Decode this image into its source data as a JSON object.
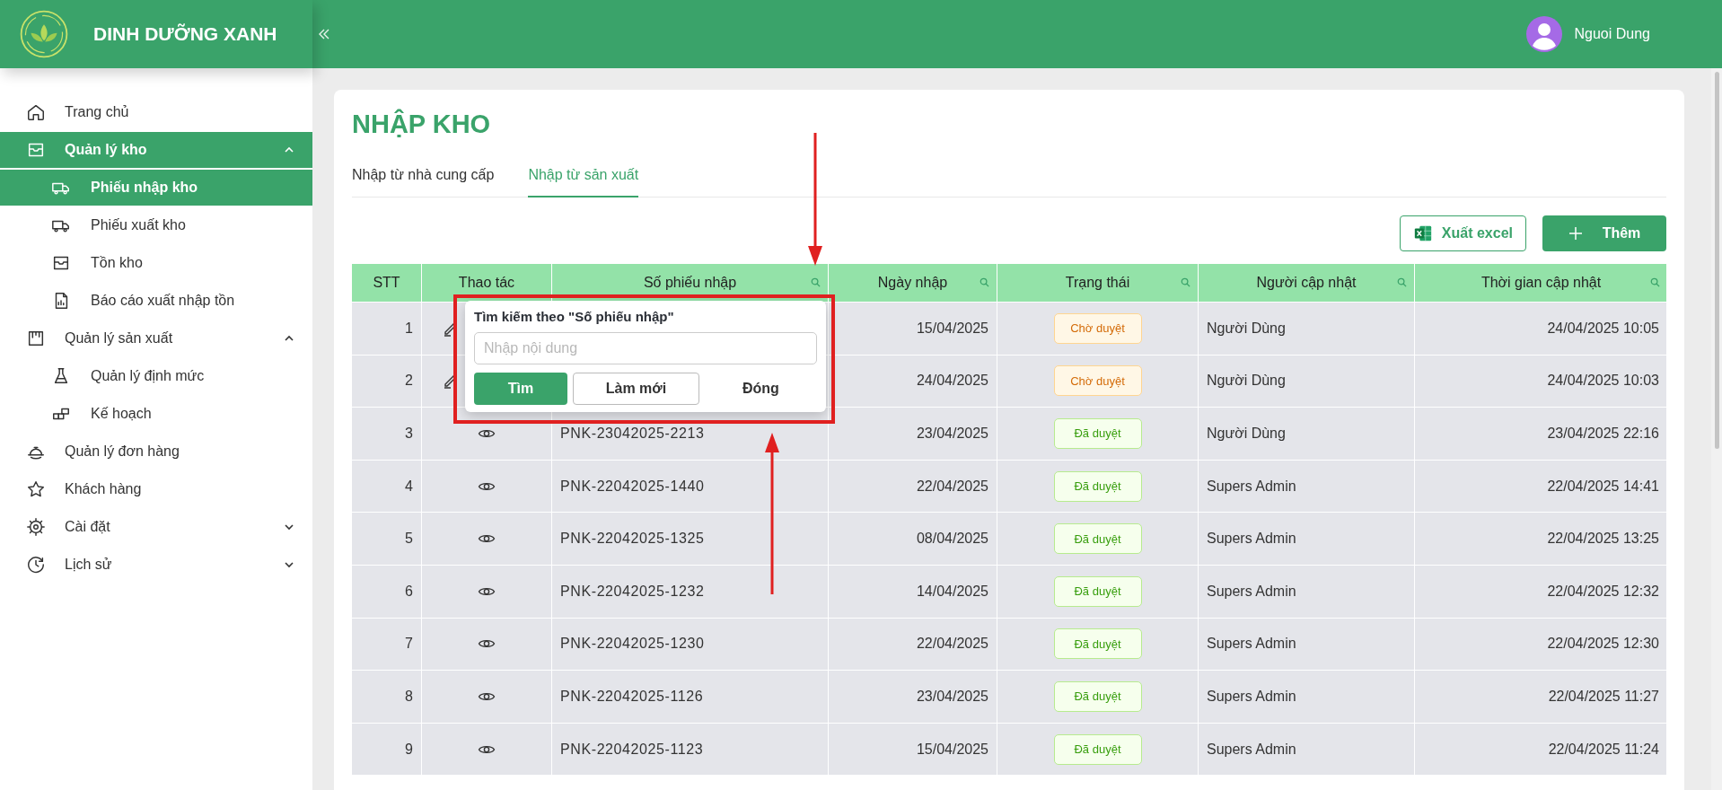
{
  "app": {
    "brand": "DINH DƯỠNG XANH"
  },
  "user": {
    "name": "Nguoi Dung"
  },
  "sidebar": {
    "items": [
      {
        "label": "Trang chủ",
        "selected": false
      },
      {
        "label": "Quản lý kho",
        "selected": true,
        "expanded": true,
        "children": [
          {
            "label": "Phiếu nhập kho",
            "selected": true
          },
          {
            "label": "Phiếu xuất kho",
            "selected": false
          },
          {
            "label": "Tồn kho",
            "selected": false
          },
          {
            "label": "Báo cáo xuất nhập tồn",
            "selected": false
          }
        ]
      },
      {
        "label": "Quản lý sản xuất",
        "selected": false,
        "expanded": true,
        "children": [
          {
            "label": "Quản lý định mức",
            "selected": false
          },
          {
            "label": "Kế hoạch",
            "selected": false
          }
        ]
      },
      {
        "label": "Quản lý đơn hàng",
        "selected": false
      },
      {
        "label": "Khách hàng",
        "selected": false
      },
      {
        "label": "Cài đặt",
        "selected": false,
        "expanded": false
      },
      {
        "label": "Lịch sử",
        "selected": false,
        "expanded": false
      }
    ]
  },
  "page": {
    "title": "NHẬP KHO",
    "tabs": [
      {
        "label": "Nhập từ nhà cung cấp",
        "selected": false
      },
      {
        "label": "Nhập từ sản xuất",
        "selected": true
      }
    ],
    "actions": {
      "export": "Xuất excel",
      "add": "Thêm"
    }
  },
  "table": {
    "columns": [
      {
        "label": "STT",
        "filterable": false
      },
      {
        "label": "Thao tác",
        "filterable": false
      },
      {
        "label": "Số phiếu nhập",
        "filterable": true
      },
      {
        "label": "Ngày nhập",
        "filterable": true
      },
      {
        "label": "Trạng thái",
        "filterable": true
      },
      {
        "label": "Người cập nhật",
        "filterable": true
      },
      {
        "label": "Thời gian cập nhật",
        "filterable": true
      }
    ],
    "rows": [
      {
        "stt": "1",
        "kind": "edit",
        "date": "15/04/2025",
        "status": {
          "label": "Chờ duyệt",
          "kind": "pending"
        },
        "updated_by": "Người Dùng",
        "updated_at": "24/04/2025 10:05"
      },
      {
        "stt": "2",
        "kind": "edit",
        "date": "24/04/2025",
        "status": {
          "label": "Chờ duyệt",
          "kind": "pending"
        },
        "updated_by": "Người Dùng",
        "updated_at": "24/04/2025 10:03"
      },
      {
        "stt": "3",
        "kind": "view",
        "receipt_no": "PNK-23042025-2213",
        "date": "23/04/2025",
        "status": {
          "label": "Đã duyệt",
          "kind": "approved"
        },
        "updated_by": "Người Dùng",
        "updated_at": "23/04/2025 22:16"
      },
      {
        "stt": "4",
        "kind": "view",
        "receipt_no": "PNK-22042025-1440",
        "date": "22/04/2025",
        "status": {
          "label": "Đã duyệt",
          "kind": "approved"
        },
        "updated_by": "Supers Admin",
        "updated_at": "22/04/2025 14:41"
      },
      {
        "stt": "5",
        "kind": "view",
        "receipt_no": "PNK-22042025-1325",
        "date": "08/04/2025",
        "status": {
          "label": "Đã duyệt",
          "kind": "approved"
        },
        "updated_by": "Supers Admin",
        "updated_at": "22/04/2025 13:25"
      },
      {
        "stt": "6",
        "kind": "view",
        "receipt_no": "PNK-22042025-1232",
        "date": "14/04/2025",
        "status": {
          "label": "Đã duyệt",
          "kind": "approved"
        },
        "updated_by": "Supers Admin",
        "updated_at": "22/04/2025 12:32"
      },
      {
        "stt": "7",
        "kind": "view",
        "receipt_no": "PNK-22042025-1230",
        "date": "22/04/2025",
        "status": {
          "label": "Đã duyệt",
          "kind": "approved"
        },
        "updated_by": "Supers Admin",
        "updated_at": "22/04/2025 12:30"
      },
      {
        "stt": "8",
        "kind": "view",
        "receipt_no": "PNK-22042025-1126",
        "date": "23/04/2025",
        "status": {
          "label": "Đã duyệt",
          "kind": "approved"
        },
        "updated_by": "Supers Admin",
        "updated_at": "22/04/2025 11:27"
      },
      {
        "stt": "9",
        "kind": "view",
        "receipt_no": "PNK-22042025-1123",
        "date": "15/04/2025",
        "status": {
          "label": "Đã duyệt",
          "kind": "approved"
        },
        "updated_by": "Supers Admin",
        "updated_at": "22/04/2025 11:24"
      }
    ]
  },
  "filter_popup": {
    "title": "Tìm kiếm theo \"Số phiếu nhập\"",
    "placeholder": "Nhập nội dung",
    "buttons": {
      "search": "Tìm",
      "reset": "Làm mới",
      "close": "Đóng"
    }
  }
}
